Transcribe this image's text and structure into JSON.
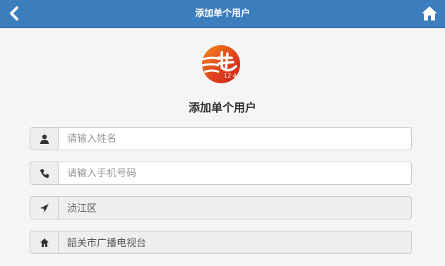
{
  "header": {
    "title": "添加单个用户",
    "back_icon": "chevron-left-icon",
    "home_icon": "home-icon",
    "bar_color": "#3b7dbd"
  },
  "logo": {
    "text": "12·4",
    "colors": {
      "red": "#d42b1e",
      "orange": "#f08a1e"
    }
  },
  "page": {
    "title": "添加单个用户"
  },
  "form": {
    "name": {
      "icon": "user-icon",
      "value": "",
      "placeholder": "请输入姓名"
    },
    "phone": {
      "icon": "phone-icon",
      "value": "",
      "placeholder": "请输入手机号码"
    },
    "district": {
      "icon": "location-arrow-icon",
      "value": "浈江区",
      "placeholder": ""
    },
    "organization": {
      "icon": "home-icon",
      "value": "韶关市广播电视台",
      "placeholder": ""
    }
  }
}
